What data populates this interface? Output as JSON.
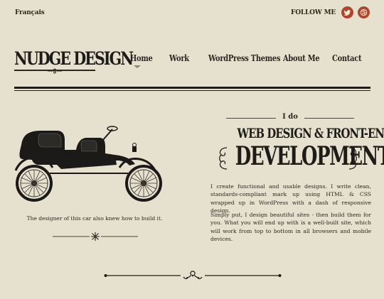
{
  "topbar": {
    "language": "Français",
    "follow_label": "FOLLOW ME",
    "social": [
      {
        "icon": "twitter-icon",
        "color": "#b0452a"
      },
      {
        "icon": "dribbble-icon",
        "color": "#b0452a"
      }
    ]
  },
  "brand": {
    "logo_text": "NUDGE DESIGN"
  },
  "nav": {
    "items": [
      {
        "label": "Home",
        "active": true
      },
      {
        "label": "Work"
      },
      {
        "label": "WordPress Themes"
      },
      {
        "label": "About Me"
      },
      {
        "label": "Contact"
      }
    ]
  },
  "car": {
    "caption": "The designer of this car also knew how to build it."
  },
  "hero": {
    "kicker": "I do",
    "line1": "WEB DESIGN & FRONT-END",
    "line2": "DEVELOPMENT",
    "paragraphs": [
      "I create functional and usable designs. I write clean, standards-compliant mark up using HTML & CSS wrapped up in WordPress with a dash of responsive design.",
      "Simply put, I design beautiful sites - then build them for you. What you will end up with is a well-built site, which will work from top to bottom in all browsers and mobile devices."
    ]
  },
  "colors": {
    "background": "#e6e1cf",
    "ink": "#1e1c19",
    "accent": "#b0452a"
  }
}
